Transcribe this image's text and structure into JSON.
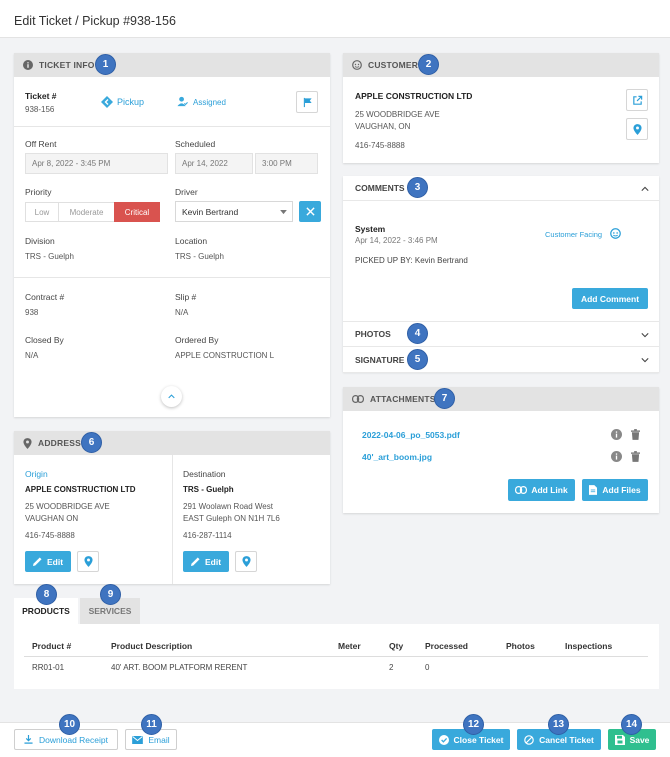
{
  "page": {
    "title": "Edit Ticket / Pickup #938-156"
  },
  "badges": [
    "1",
    "2",
    "3",
    "4",
    "5",
    "6",
    "7",
    "8",
    "9",
    "10",
    "11",
    "12",
    "13",
    "14"
  ],
  "ticket_info": {
    "header": "TICKET INFO",
    "ticket_label": "Ticket #",
    "ticket_value": "938-156",
    "type_label": "Pickup",
    "assigned_label": "Assigned",
    "off_rent_label": "Off Rent",
    "off_rent_value": "Apr 8, 2022 - 3:45 PM",
    "scheduled_label": "Scheduled",
    "scheduled_date": "Apr 14, 2022",
    "scheduled_time": "3:00 PM",
    "priority_label": "Priority",
    "priority_options": [
      "Low",
      "Moderate",
      "Critical"
    ],
    "priority_selected": "Critical",
    "driver_label": "Driver",
    "driver_value": "Kevin Bertrand",
    "division_label": "Division",
    "division_value": "TRS - Guelph",
    "location_label": "Location",
    "location_value": "TRS - Guelph",
    "contract_label": "Contract #",
    "contract_value": "938",
    "slip_label": "Slip #",
    "slip_value": "N/A",
    "closed_by_label": "Closed By",
    "closed_by_value": "N/A",
    "ordered_by_label": "Ordered By",
    "ordered_by_value": "APPLE CONSTRUCTION L"
  },
  "customer": {
    "header": "CUSTOMER",
    "name": "APPLE CONSTRUCTION LTD",
    "address1": "25 WOODBRIDGE AVE",
    "address2": "VAUGHAN, ON",
    "phone": "416-745-8888"
  },
  "comments": {
    "header": "COMMENTS",
    "author": "System",
    "date": "Apr 14, 2022 - 3:46 PM",
    "facing": "Customer Facing",
    "text": "PICKED UP BY: Kevin Bertrand",
    "add_button": "Add Comment"
  },
  "photos": {
    "header": "PHOTOS"
  },
  "signature": {
    "header": "SIGNATURE"
  },
  "attachments": {
    "header": "ATTACHMENTS",
    "files": [
      "2022-04-06_po_5053.pdf",
      "40'_art_boom.jpg"
    ],
    "add_link": "Add Link",
    "add_files": "Add Files"
  },
  "address": {
    "header": "ADDRESS",
    "origin": {
      "label": "Origin",
      "name": "APPLE CONSTRUCTION LTD",
      "line1": "25 WOODBRIDGE AVE",
      "line2": "VAUGHAN ON",
      "phone": "416-745-8888",
      "edit": "Edit"
    },
    "destination": {
      "label": "Destination",
      "name": "TRS - Guelph",
      "line1": "291 Woolawn Road West",
      "line2": "EAST Guleph ON N1H 7L6",
      "phone": "416-287-1114",
      "edit": "Edit"
    }
  },
  "tabs": {
    "products": "PRODUCTS",
    "services": "SERVICES"
  },
  "products_table": {
    "headers": [
      "Product #",
      "Product Description",
      "Meter",
      "Qty",
      "Processed",
      "Photos",
      "Inspections"
    ],
    "rows": [
      {
        "product": "RR01-01",
        "description": "40' ART. BOOM PLATFORM RERENT",
        "meter": "",
        "qty": "2",
        "processed": "0",
        "photos": "",
        "inspections": ""
      }
    ]
  },
  "footer": {
    "download": "Download Receipt",
    "email": "Email",
    "close": "Close Ticket",
    "cancel": "Cancel Ticket",
    "save": "Save"
  },
  "colors": {
    "accent": "#39a9dc",
    "critical": "#d9534f",
    "badge": "#3f74c0",
    "save": "#2fbf8f"
  }
}
